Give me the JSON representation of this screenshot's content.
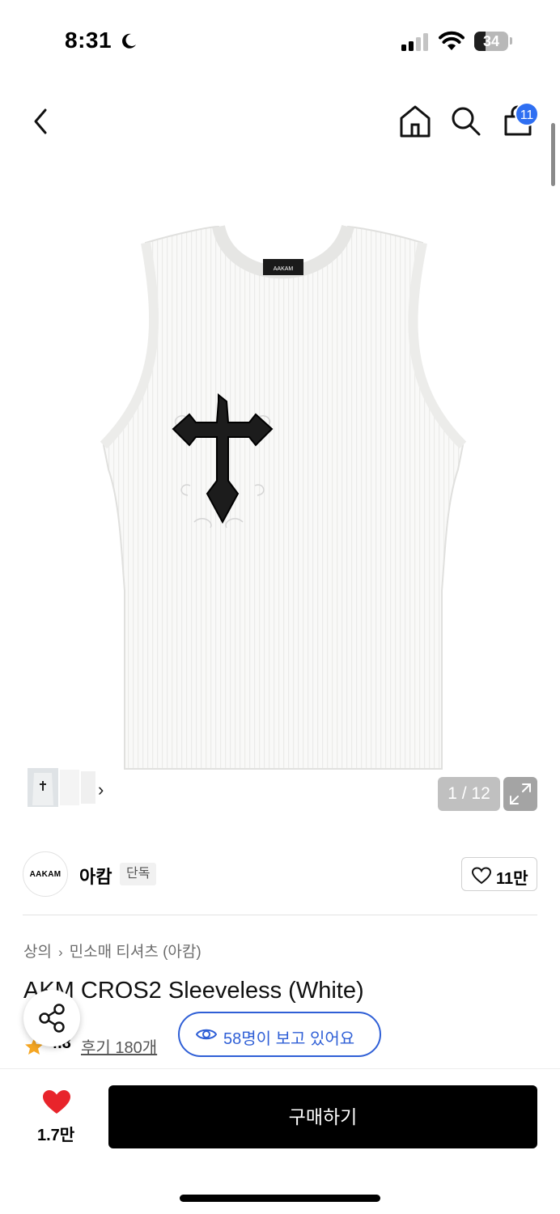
{
  "status_bar": {
    "time": "8:31",
    "battery": "34",
    "battery_level": 0.34
  },
  "nav": {
    "cart_count": "11"
  },
  "gallery": {
    "page_counter": "1 / 12",
    "product_label": "AAKAM"
  },
  "brand": {
    "logo_text": "AAKAM",
    "name": "아캄",
    "tag": "단독",
    "likes": "11만"
  },
  "breadcrumb": {
    "category": "상의",
    "subcategory": "민소매 티셔츠 (아캄)"
  },
  "product": {
    "title": "AKM CROS2 Sleeveless (White)",
    "rating": "4.8",
    "reviews": "후기 180개",
    "viewers": "58명이 보고 있어요"
  },
  "bottom": {
    "wish_count": "1.7만",
    "buy_label": "구매하기"
  },
  "colors": {
    "accent_blue": "#2f5fd6",
    "badge_blue": "#2f6ff2",
    "star": "#f5a623",
    "heart": "#e8242b"
  }
}
